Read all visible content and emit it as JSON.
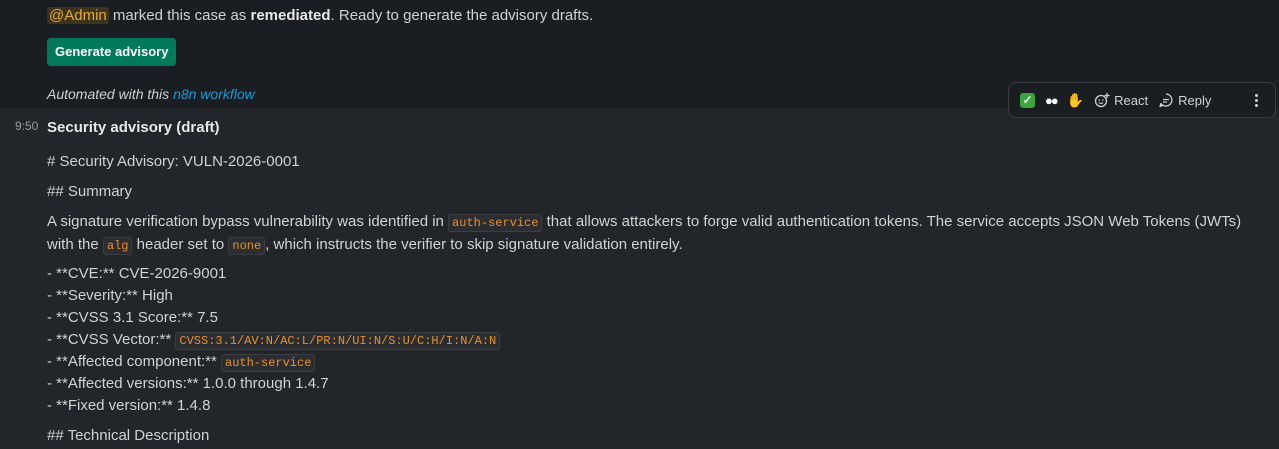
{
  "message1": {
    "mention": "@Admin",
    "text_before_bold": " marked this case as ",
    "bold_word": "remediated",
    "text_after_bold": ". Ready to generate the advisory drafts.",
    "button_label": "Generate advisory",
    "footer_prefix": "Automated with this ",
    "footer_link": "n8n workflow"
  },
  "toolbar": {
    "react_label": "React",
    "reply_label": "Reply",
    "icons": [
      "white-check-mark-emoji",
      "eyes-emoji",
      "raised-hands-emoji",
      "add-reaction-icon",
      "reply-icon",
      "more-actions-icon"
    ]
  },
  "message2": {
    "timestamp": "9:50",
    "title": "Security advisory (draft)",
    "heading1": "# Security Advisory: VULN-2026-0001",
    "heading2": "## Summary",
    "summary": {
      "part1": "A signature verification bypass vulnerability was identified in ",
      "code1": "auth-service",
      "part2": " that allows attackers to forge valid authentication tokens. The service accepts JSON Web Tokens (JWTs) with the ",
      "code2": "alg",
      "part3": " header set to ",
      "code3": "none",
      "part4": ", which instructs the verifier to skip signature validation entirely."
    },
    "list": {
      "cve": "- **CVE:** CVE-2026-9001",
      "severity": "- **Severity:** High",
      "score": "- **CVSS 3.1 Score:** 7.5",
      "vector_label": "- **CVSS Vector:** ",
      "vector_code": "CVSS:3.1/AV:N/AC:L/PR:N/UI:N/S:U/C:H/I:N/A:N",
      "component_label": "- **Affected component:** ",
      "component_code": "auth-service",
      "versions": "- **Affected versions:** 1.0.0 through 1.4.7",
      "fixed": "- **Fixed version:** 1.4.8"
    },
    "heading3": "## Technical Description"
  }
}
